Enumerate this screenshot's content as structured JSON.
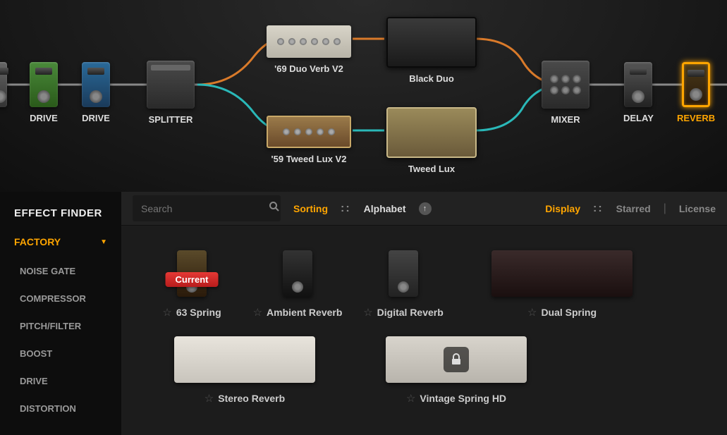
{
  "chain": {
    "drive1": "DRIVE",
    "drive2": "DRIVE",
    "splitter": "SPLITTER",
    "amp_top": "'69 Duo Verb V2",
    "cab_top": "Black Duo",
    "amp_bot": "'59 Tweed Lux V2",
    "cab_bot": "Tweed Lux",
    "mixer": "MIXER",
    "delay": "DELAY",
    "reverb": "REVERB"
  },
  "sidebar": {
    "title": "EFFECT FINDER",
    "section": "FACTORY",
    "items": [
      "NOISE GATE",
      "COMPRESSOR",
      "PITCH/FILTER",
      "BOOST",
      "DRIVE",
      "DISTORTION"
    ]
  },
  "toolbar": {
    "search_placeholder": "Search",
    "sorting_label": "Sorting",
    "sorting_value": "Alphabet",
    "display_label": "Display",
    "starred": "Starred",
    "license": "License"
  },
  "effects": {
    "r1": [
      {
        "name": "63 Spring",
        "type": "pedal",
        "color": "#3a2a18",
        "current": true
      },
      {
        "name": "Ambient Reverb",
        "type": "pedal",
        "color": "#2a2a2a"
      },
      {
        "name": "Digital Reverb",
        "type": "pedal",
        "color": "#3a3a3a"
      },
      {
        "name": "Dual Spring",
        "type": "rack",
        "bg": "linear-gradient(#3a2a2a,#1a0f0f)"
      }
    ],
    "r2": [
      {
        "name": "Stereo Reverb",
        "type": "rack",
        "bg": "linear-gradient(#e8e4dc,#c8c4bc)"
      },
      {
        "name": "Vintage Spring HD",
        "type": "rack",
        "bg": "linear-gradient(#d8d4cc,#b8b4ac)",
        "locked": true
      }
    ]
  },
  "current_label": "Current"
}
